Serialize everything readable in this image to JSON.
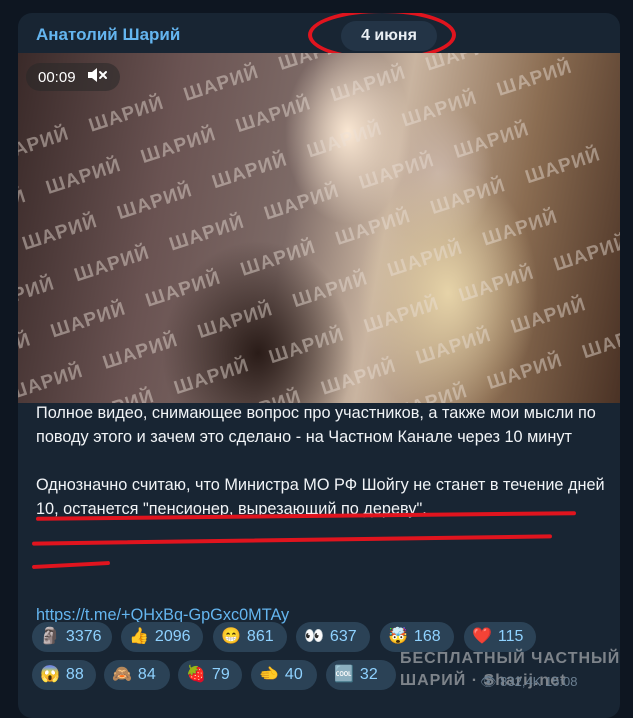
{
  "header": {
    "channel_name": "Анатолий Шарий",
    "date": "4 июня"
  },
  "video": {
    "timestamp": "00:09",
    "mute_icon": "speaker-muted-icon",
    "watermark": "ШАРИЙ"
  },
  "message": {
    "paragraph1": "Полное видео, снимающее вопрос про участников, а также мои мысли по поводу этого и зачем это сделано - на Частном Канале через 10 минут",
    "paragraph2": "Однозначно считаю, что Министра МО РФ Шойгу не станет в течение дней 10, останется \"пенсионер, вырезающий по дереву\".",
    "link": "https://t.me/+QHxBq-GpGxc0MTAy"
  },
  "reactions": [
    {
      "emoji": "🗿",
      "count": "3376"
    },
    {
      "emoji": "👍",
      "count": "2096"
    },
    {
      "emoji": "😁",
      "count": "861"
    },
    {
      "emoji": "👀",
      "count": "637"
    },
    {
      "emoji": "🤯",
      "count": "168"
    },
    {
      "emoji": "❤️",
      "count": "115"
    },
    {
      "emoji": "😱",
      "count": "88"
    },
    {
      "emoji": "🙈",
      "count": "84"
    },
    {
      "emoji": "🍓",
      "count": "79"
    },
    {
      "emoji": "🫲",
      "count": "40"
    },
    {
      "emoji": "🆒",
      "count": "32"
    }
  ],
  "overlay": {
    "line1": "БЕСПЛАТНЫЙ ЧАСТНЫЙ",
    "line2": "ШАРИЙ · Sharij.net"
  },
  "meta": {
    "views": "832,4K",
    "time": "15:08"
  },
  "colors": {
    "accent": "#64b5ef",
    "highlight": "#e0141e"
  }
}
